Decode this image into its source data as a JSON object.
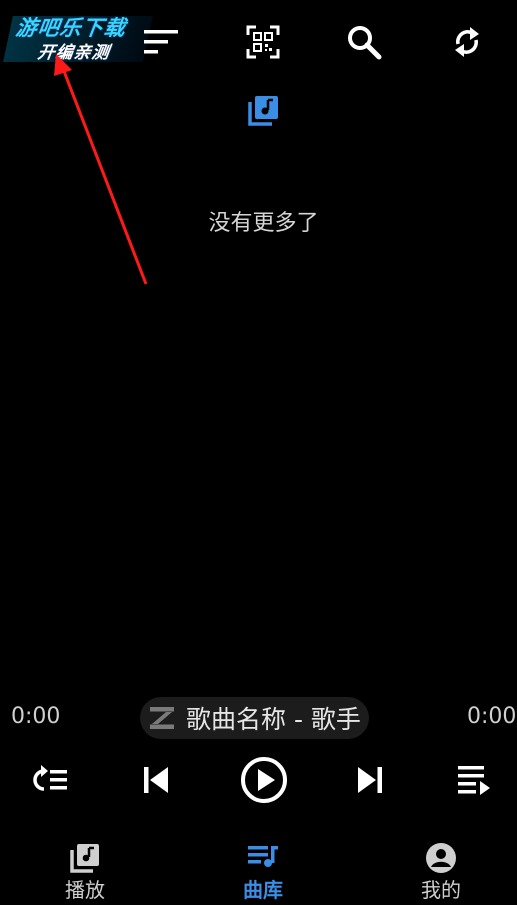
{
  "watermark": {
    "line1": "游吧乐下载",
    "line2": "开编亲测"
  },
  "toolbar": {
    "icons": [
      "sort-icon",
      "qr-scan-icon",
      "search-icon",
      "refresh-icon"
    ]
  },
  "library": {
    "header_icon": "music-library-icon",
    "empty_message": "没有更多了"
  },
  "player": {
    "current_time": "0:00",
    "total_time": "0:00",
    "track_display": "歌曲名称 - 歌手",
    "progress": 0,
    "controls": [
      "repeat-list-icon",
      "previous-icon",
      "play-icon",
      "next-icon",
      "playlist-icon"
    ]
  },
  "bottom_nav": {
    "active_color": "#3a8ee6",
    "inactive_color": "#cfcfcf",
    "tabs": [
      {
        "label": "播放",
        "icon": "music-library-icon",
        "active": false
      },
      {
        "label": "曲库",
        "icon": "queue-music-icon",
        "active": true
      },
      {
        "label": "我的",
        "icon": "account-icon",
        "active": false
      }
    ]
  },
  "colors": {
    "accent": "#3a8ee6",
    "background": "#000000",
    "annotation_arrow": "#ff1a1a"
  }
}
